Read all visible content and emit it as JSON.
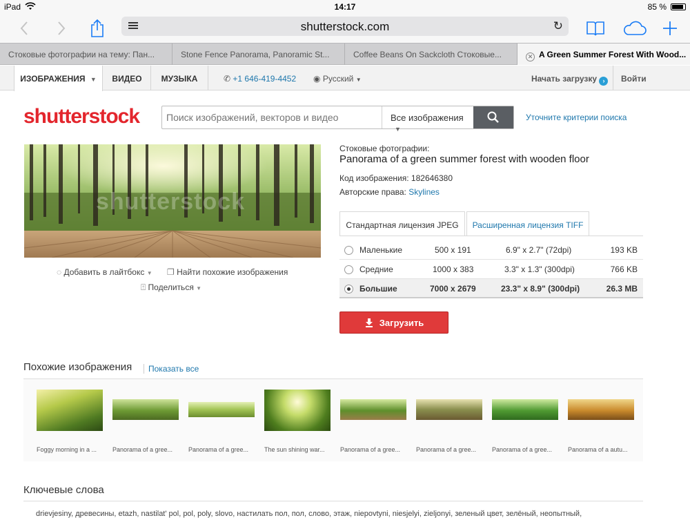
{
  "status": {
    "device": "iPad",
    "time": "14:17",
    "battery": "85 %"
  },
  "browser": {
    "url": "shutterstock.com"
  },
  "tabs": [
    {
      "label": "Стоковые фотографии на тему: Пан..."
    },
    {
      "label": "Stone Fence Panorama, Panoramic St..."
    },
    {
      "label": "Coffee Beans On Sackcloth Стоковые..."
    },
    {
      "label": "A Green Summer Forest With Wood..."
    }
  ],
  "nav": {
    "images": "ИЗОБРАЖЕНИЯ",
    "video": "ВИДЕО",
    "music": "МУЗЫКА",
    "phone": "+1 646-419-4452",
    "language": "Русский",
    "upload": "Начать загрузку",
    "login": "Войти"
  },
  "site": {
    "logo": "shutterstock"
  },
  "search": {
    "placeholder": "Поиск изображений, векторов и видео",
    "scope": "Все изображения",
    "refine": "Уточните критерии поиска"
  },
  "image": {
    "category": "Стоковые фотографии:",
    "title": "Panorama of a green summer forest with wooden floor",
    "id_label": "Код изображения:",
    "id": "182646380",
    "author_label": "Авторские права:",
    "author": "Skylines",
    "add_lightbox": "Добавить в лайтбокс",
    "find_similar": "Найти похожие изображения",
    "share": "Поделиться",
    "watermark": "shutterstock"
  },
  "license": {
    "standard": "Стандартная лицензия JPEG",
    "extended": "Расширенная лицензия TIFF",
    "sizes": [
      {
        "name": "Маленькие",
        "px": "500 x 191",
        "inches": "6.9\" x 2.7\" (72dpi)",
        "file": "193 KB",
        "selected": false
      },
      {
        "name": "Средние",
        "px": "1000 x 383",
        "inches": "3.3\" x 1.3\" (300dpi)",
        "file": "766 KB",
        "selected": false
      },
      {
        "name": "Большие",
        "px": "7000 x 2679",
        "inches": "23.3\" x 8.9\" (300dpi)",
        "file": "26.3 MB",
        "selected": true
      }
    ],
    "download": "Загрузить"
  },
  "similar": {
    "heading": "Похожие изображения",
    "show_all": "Показать все",
    "items": [
      {
        "caption": "Foggy morning in a ..."
      },
      {
        "caption": "Panorama of a gree..."
      },
      {
        "caption": "Panorama of a gree..."
      },
      {
        "caption": "The sun shining war..."
      },
      {
        "caption": "Panorama of a gree..."
      },
      {
        "caption": "Panorama of a gree..."
      },
      {
        "caption": "Panorama of a gree..."
      },
      {
        "caption": "Panorama of a autu..."
      }
    ]
  },
  "keywords": {
    "heading": "Ключевые слова",
    "text": "drievjesiny, древесины, etazh, nastilat' pol, pol, poly, slovo, настилать пол, пол, слово, этаж, niepovtyni, niesjelyi, zieljonyi, зеленый цвет, зелёный, неопытный,"
  },
  "colors": {
    "brand": "#e3262d",
    "link": "#1e77ac",
    "download": "#e03a3a"
  }
}
